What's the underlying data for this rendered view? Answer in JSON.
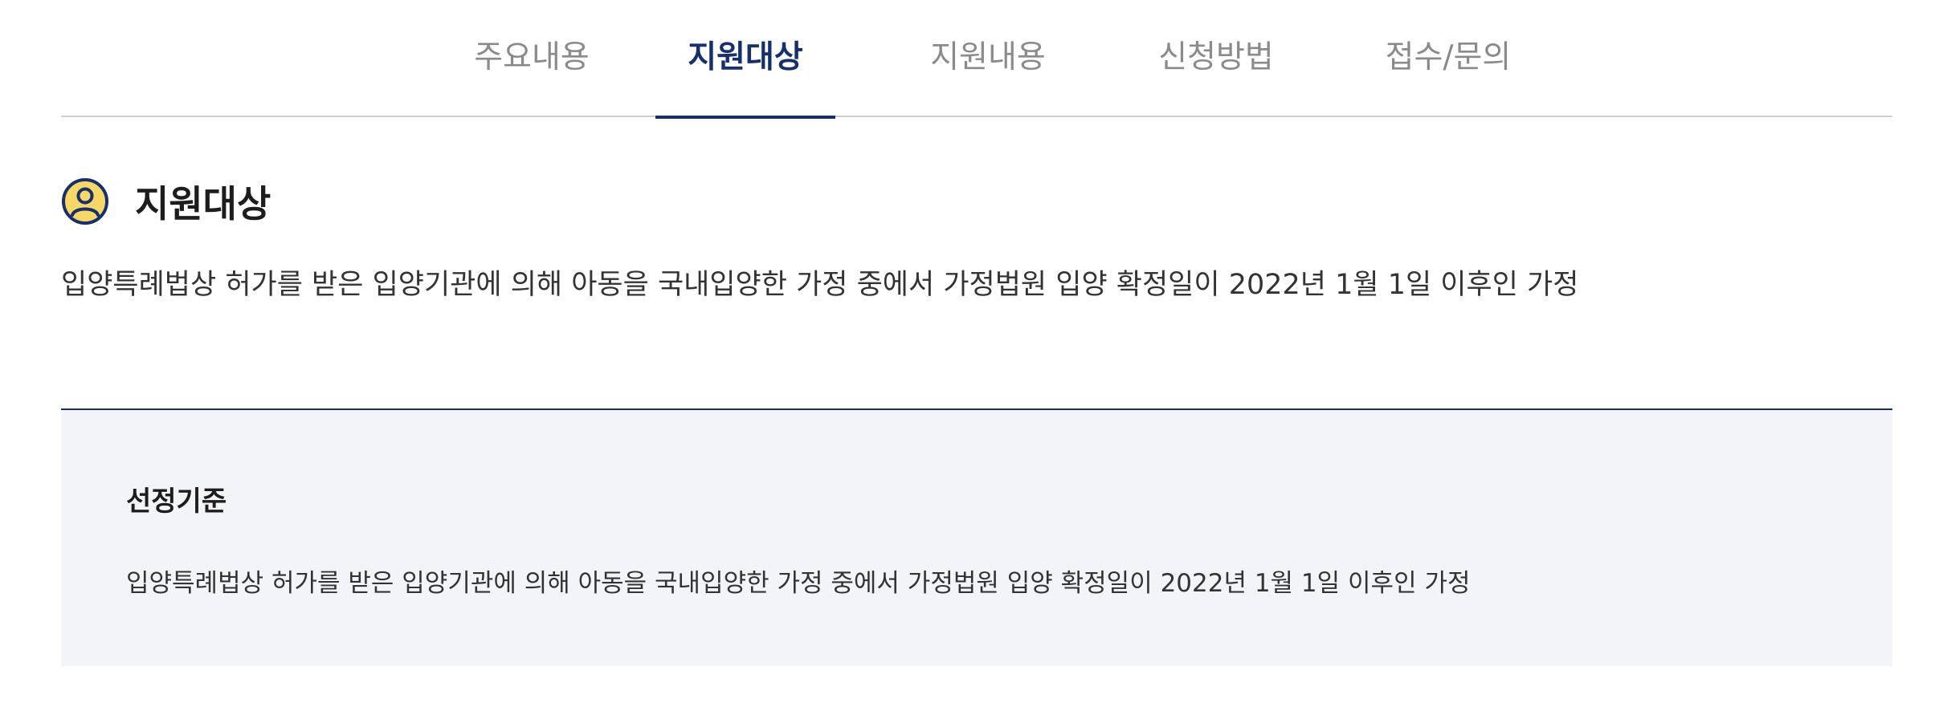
{
  "tabs": [
    {
      "label": "주요내용",
      "active": false
    },
    {
      "label": "지원대상",
      "active": true
    },
    {
      "label": "지원내용",
      "active": false
    },
    {
      "label": "신청방법",
      "active": false
    },
    {
      "label": "접수/문의",
      "active": false
    }
  ],
  "section": {
    "icon": "user-circle-icon",
    "title": "지원대상",
    "description": "입양특례법상 허가를 받은 입양기관에 의해 아동을 국내입양한 가정 중에서 가정법원 입양 확정일이 2022년 1월 1일 이후인 가정"
  },
  "criteria": {
    "title": "선정기준",
    "text": "입양특례법상 허가를 받은 입양기관에 의해 아동을 국내입양한 가정 중에서 가정법원 입양 확정일이 2022년 1월 1일 이후인 가정"
  },
  "colors": {
    "accent": "#16306d",
    "icon_fill": "#f7d867",
    "box_background": "#f2f4f8",
    "inactive_tab": "#8a8a8a"
  }
}
